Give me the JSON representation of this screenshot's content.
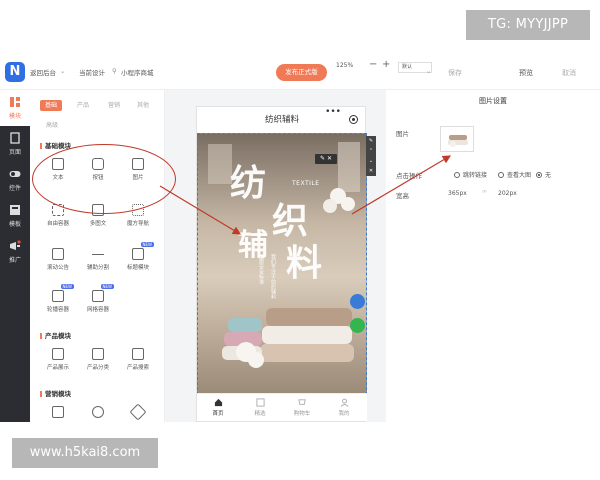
{
  "watermark": "TG: MYYJJPP",
  "footer_link": "www.h5kai8.com",
  "topbar": {
    "back": "返回后台",
    "current_design": "当前设计",
    "app_name": "小程序商城",
    "publish": "发布正式版",
    "zoom": "125%",
    "zoom_minus": "−",
    "zoom_plus": "+",
    "device": "默认",
    "save": "保存",
    "preview": "预览",
    "cancel": "取消"
  },
  "rail": [
    {
      "label": "模块",
      "icon": "module-icon"
    },
    {
      "label": "页面",
      "icon": "page-icon"
    },
    {
      "label": "控件",
      "icon": "toggle-icon"
    },
    {
      "label": "模板",
      "icon": "template-icon"
    },
    {
      "label": "推广",
      "icon": "promo-icon"
    }
  ],
  "panel": {
    "tabs": [
      "基础",
      "产品",
      "营销",
      "其他",
      "高级"
    ],
    "sections": [
      {
        "title": "基础模块",
        "items": [
          {
            "label": "文本",
            "icon": "text-icon"
          },
          {
            "label": "按钮",
            "icon": "button-icon"
          },
          {
            "label": "图片",
            "icon": "image-icon"
          },
          {
            "label": "自由容器",
            "icon": "container-icon"
          },
          {
            "label": "多图文",
            "icon": "gallery-icon"
          },
          {
            "label": "魔方导航",
            "icon": "grid-nav-icon"
          },
          {
            "label": "滚动公告",
            "icon": "notice-icon"
          },
          {
            "label": "辅助分割",
            "icon": "divider-icon"
          },
          {
            "label": "标题模块",
            "icon": "title-icon",
            "tag": "NEW"
          },
          {
            "label": "轮播容器",
            "icon": "carousel-icon",
            "tag": "NEW"
          },
          {
            "label": "网格容器",
            "icon": "grid-container-icon",
            "tag": "NEW"
          }
        ]
      },
      {
        "title": "产品模块",
        "items": [
          {
            "label": "产品展示",
            "icon": "product-icon"
          },
          {
            "label": "产品分类",
            "icon": "category-icon"
          },
          {
            "label": "产品搜索",
            "icon": "product-search-icon"
          }
        ]
      },
      {
        "title": "营销模块",
        "items": [
          {
            "label": "",
            "icon": "ticket-icon"
          },
          {
            "label": "",
            "icon": "group-icon"
          },
          {
            "label": "",
            "icon": "coupon-icon"
          }
        ]
      }
    ]
  },
  "phone": {
    "title": "纺织辅料",
    "menu_dots": "•••",
    "banner": {
      "chars": [
        "纺",
        "织",
        "辅",
        "料"
      ],
      "english": "TEXTILE",
      "tagline": "我们专注于纺织辅料",
      "tagline2": "品质安全标准"
    },
    "tabbar": [
      {
        "label": "首页",
        "icon": "home-icon",
        "active": true
      },
      {
        "label": "精选",
        "icon": "grid-icon",
        "active": false
      },
      {
        "label": "购物车",
        "icon": "cart-icon",
        "active": false
      },
      {
        "label": "我的",
        "icon": "user-icon",
        "active": false
      }
    ]
  },
  "settings": {
    "title": "图片设置",
    "image_label": "图片",
    "click_action_label": "点击操作",
    "options": [
      "跳转链接",
      "查看大图",
      "无"
    ],
    "selected_option": "无",
    "size_label": "宽高",
    "width": "365px",
    "height": "202px"
  },
  "colors": {
    "accent": "#f07a55",
    "rail_bg": "#2b2d33",
    "annotation": "#c0392b",
    "logo": "#2f6fe4"
  }
}
